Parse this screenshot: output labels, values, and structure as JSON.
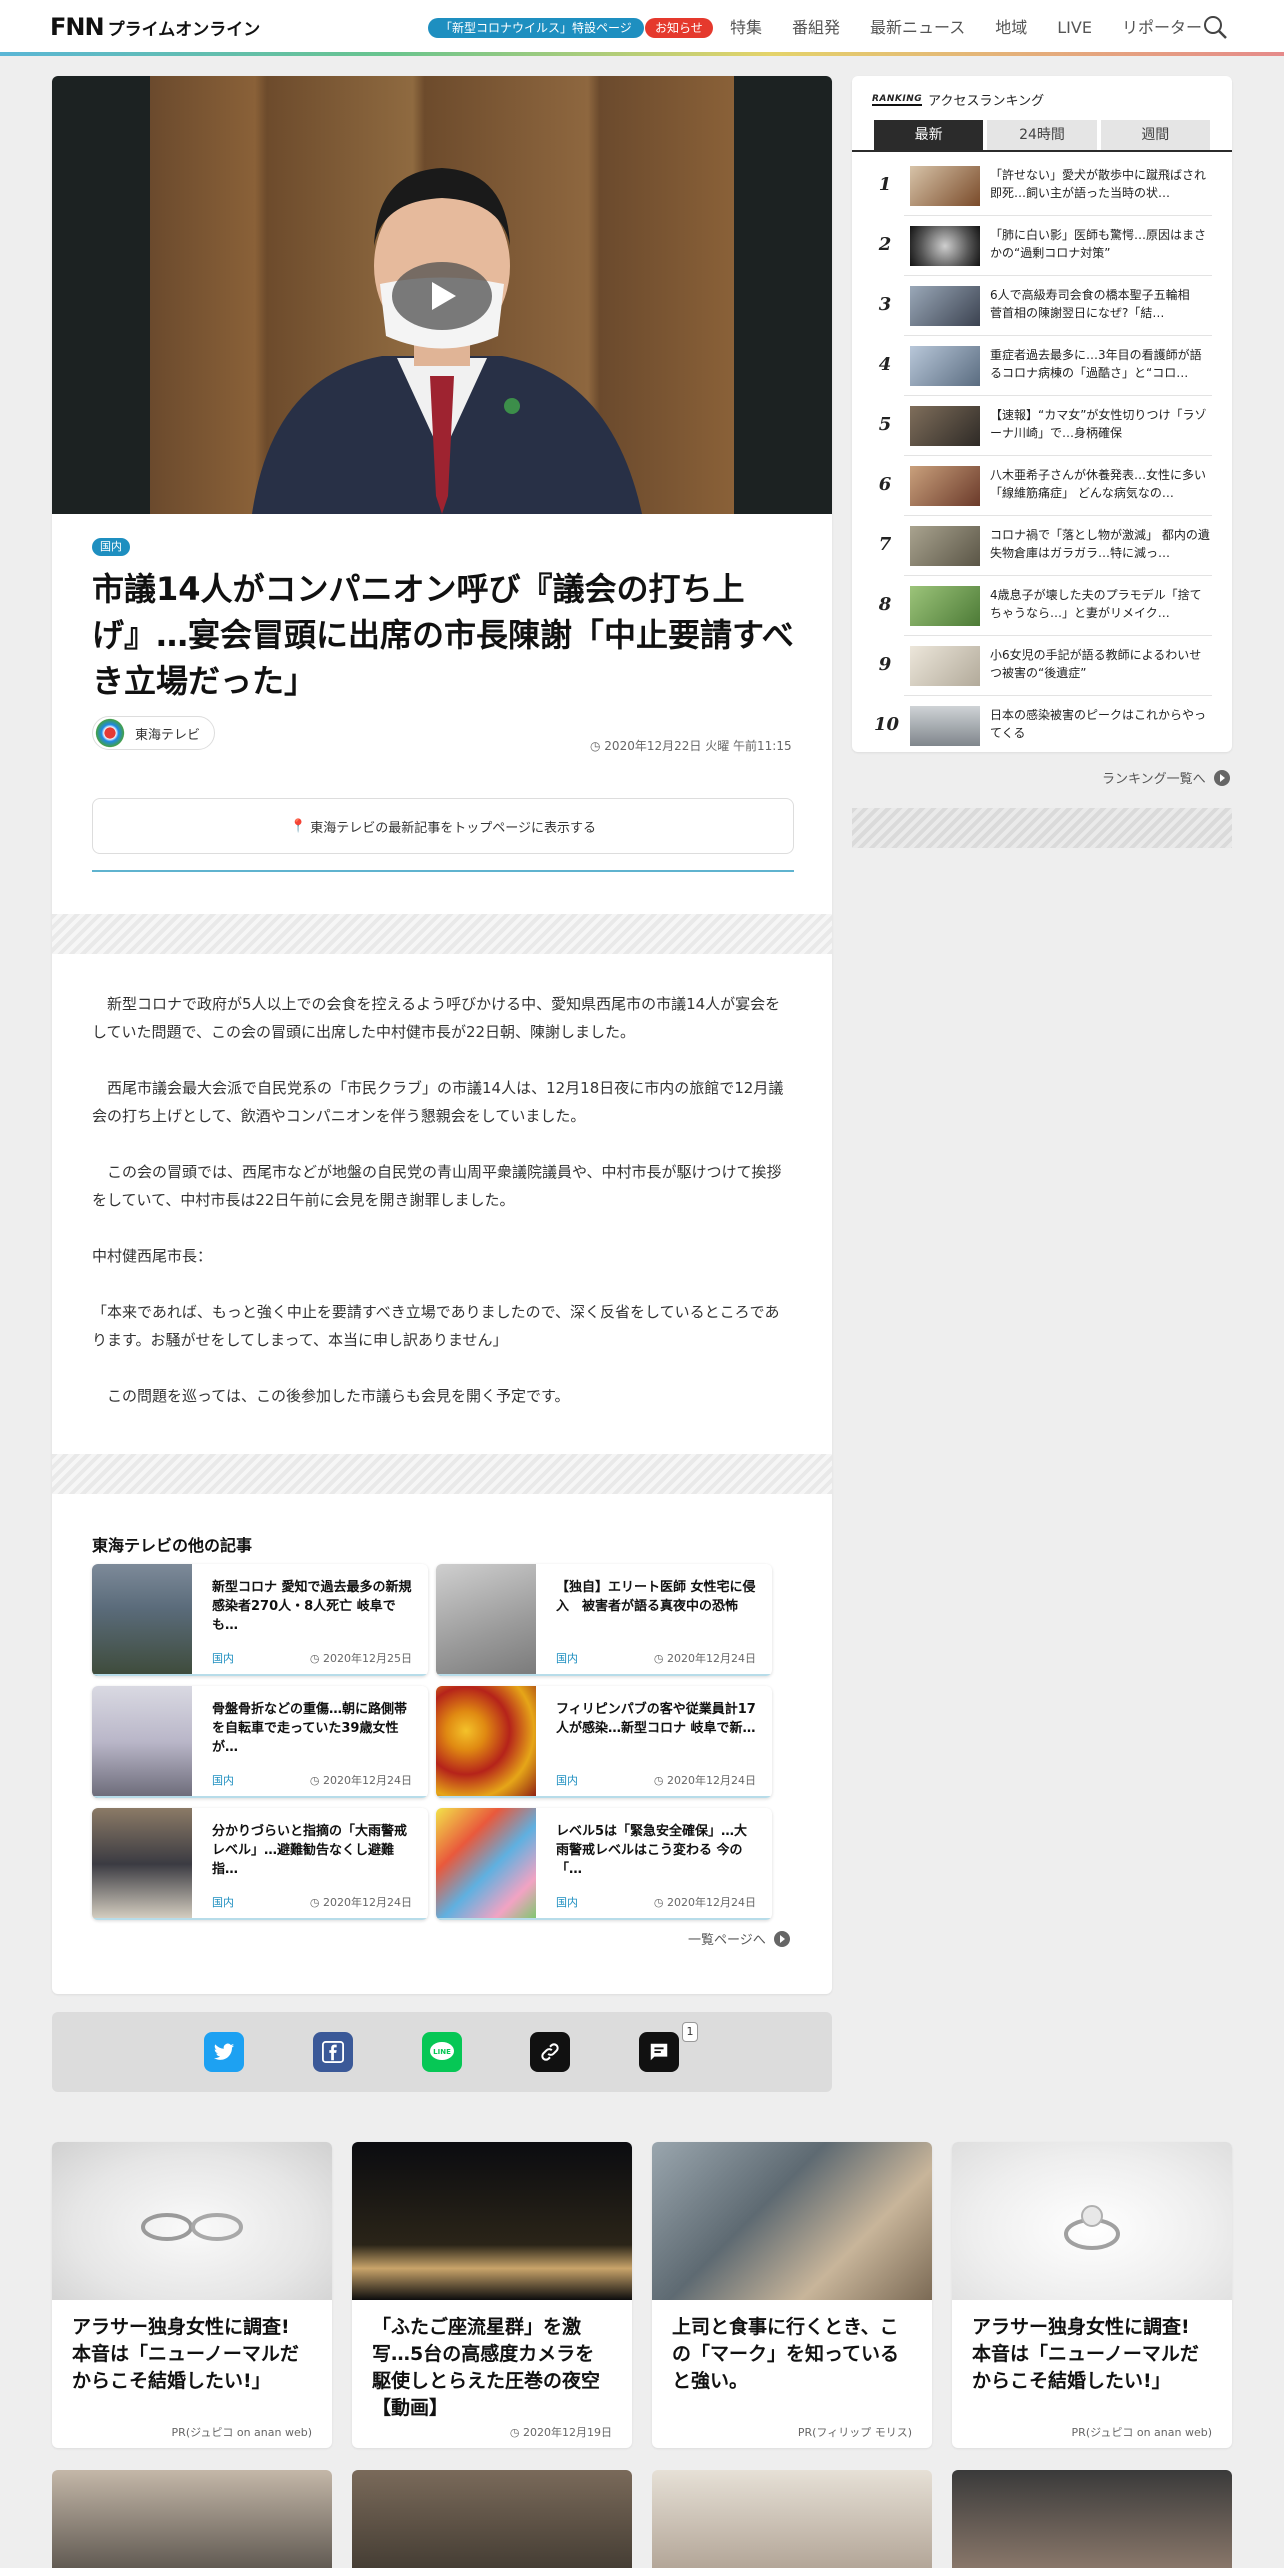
{
  "header": {
    "logo_main": "FNN",
    "logo_sub": "プライムオンライン",
    "covid_pill": "「新型コロナウイルス」特設ページ",
    "notice_pill": "お知らせ",
    "nav": [
      "特集",
      "番組発",
      "最新ニュース",
      "地域",
      "LIVE",
      "リポーター"
    ]
  },
  "article": {
    "category": "国内",
    "title": "市議14人がコンパニオン呼び『議会の打ち上げ』…宴会冒頭に出席の市長陳謝「中止要請すべき立場だった」",
    "source": "東海テレビ",
    "datetime": "2020年12月22日 火曜 午前11:15",
    "pin_label": "東海テレビの最新記事をトップページに表示する",
    "paragraphs": [
      "　新型コロナで政府が5人以上での会食を控えるよう呼びかける中、愛知県西尾市の市議14人が宴会をしていた問題で、この会の冒頭に出席した中村健市長が22日朝、陳謝しました。",
      "　西尾市議会最大会派で自民党系の「市民クラブ」の市議14人は、12月18日夜に市内の旅館で12月議会の打ち上げとして、飲酒やコンパニオンを伴う懇親会をしていました。",
      "　この会の冒頭では、西尾市などが地盤の自民党の青山周平衆議院議員や、中村市長が駆けつけて挨拶をしていて、中村市長は22日午前に会見を開き謝罪しました。",
      "中村健西尾市長：",
      "「本来であれば、もっと強く中止を要請すべき立場でありましたので、深く反省をしているところであります。お騒がせをしてしまって、本当に申し訳ありません」",
      "　この問題を巡っては、この後参加した市議らも会見を開く予定です。"
    ]
  },
  "related": {
    "heading": "東海テレビの他の記事",
    "more": "一覧ページへ",
    "items": [
      {
        "title": "新型コロナ 愛知で過去最多の新規感染者270人・8人死亡 岐阜でも…",
        "category": "国内",
        "date": "2020年12月25日"
      },
      {
        "title": "【独自】エリート医師 女性宅に侵入　被害者が語る真夜中の恐怖",
        "category": "国内",
        "date": "2020年12月24日"
      },
      {
        "title": "骨盤骨折などの重傷…朝に路側帯を自転車で走っていた39歳女性が…",
        "category": "国内",
        "date": "2020年12月24日"
      },
      {
        "title": "フィリピンパブの客や従業員計17人が感染…新型コロナ 岐阜で新…",
        "category": "国内",
        "date": "2020年12月24日"
      },
      {
        "title": "分かりづらいと指摘の「大雨警戒レベル」…避難勧告なくし避難指…",
        "category": "国内",
        "date": "2020年12月24日"
      },
      {
        "title": "レベル5は「緊急安全確保」…大雨警戒レベルはこう変わる 今の「…",
        "category": "国内",
        "date": "2020年12月24日"
      }
    ]
  },
  "share": {
    "comment_count": "1"
  },
  "ranking": {
    "badge": "RANKING",
    "heading": "アクセスランキング",
    "tabs": [
      "最新",
      "24時間",
      "週間"
    ],
    "more": "ランキング一覧へ",
    "items": [
      {
        "rank": "1",
        "text": "「許せない」愛犬が散歩中に蹴飛ばされ即死…飼い主が語った当時の状…"
      },
      {
        "rank": "2",
        "text": "「肺に白い影」医師も驚愕…原因はまさかの“過剰コロナ対策”"
      },
      {
        "rank": "3",
        "text": "6人で高級寿司会食の橋本聖子五輪相　菅首相の陳謝翌日になぜ?「結…"
      },
      {
        "rank": "4",
        "text": "重症者過去最多に…3年目の看護師が語るコロナ病棟の「過酷さ」と“コロ…"
      },
      {
        "rank": "5",
        "text": "【速報】“カマ女”が女性切りつけ「ラゾーナ川崎」で…身柄確保"
      },
      {
        "rank": "6",
        "text": "八木亜希子さんが休養発表…女性に多い「線維筋痛症」 どんな病気なの…"
      },
      {
        "rank": "7",
        "text": "コロナ禍で「落とし物が激減」 都内の遺失物倉庫はガラガラ…特に減っ…"
      },
      {
        "rank": "8",
        "text": "4歳息子が壊した夫のプラモデル「捨てちゃうなら…」と妻がリメイク…"
      },
      {
        "rank": "9",
        "text": "小6女児の手記が語る教師によるわいせつ被害の“後遺症”"
      },
      {
        "rank": "10",
        "text": "日本の感染被害のピークはこれからやってくる"
      }
    ]
  },
  "ads": [
    {
      "title": "アラサー独身女性に調査! 本音は「ニューノーマルだからこそ結婚したい!」",
      "meta": "PR(ジュピコ on anan web)"
    },
    {
      "title": "「ふたご座流星群」を激写…5台の高感度カメラを駆使しとらえた圧巻の夜空【動画】",
      "meta": "2020年12月19日"
    },
    {
      "title": "上司と食事に行くとき、この「マーク」を知っていると強い。",
      "meta": "PR(フィリップ モリス)"
    },
    {
      "title": "アラサー独身女性に調査! 本音は「ニューノーマルだからこそ結婚したい!」",
      "meta": "PR(ジュピコ on anan web)"
    }
  ]
}
